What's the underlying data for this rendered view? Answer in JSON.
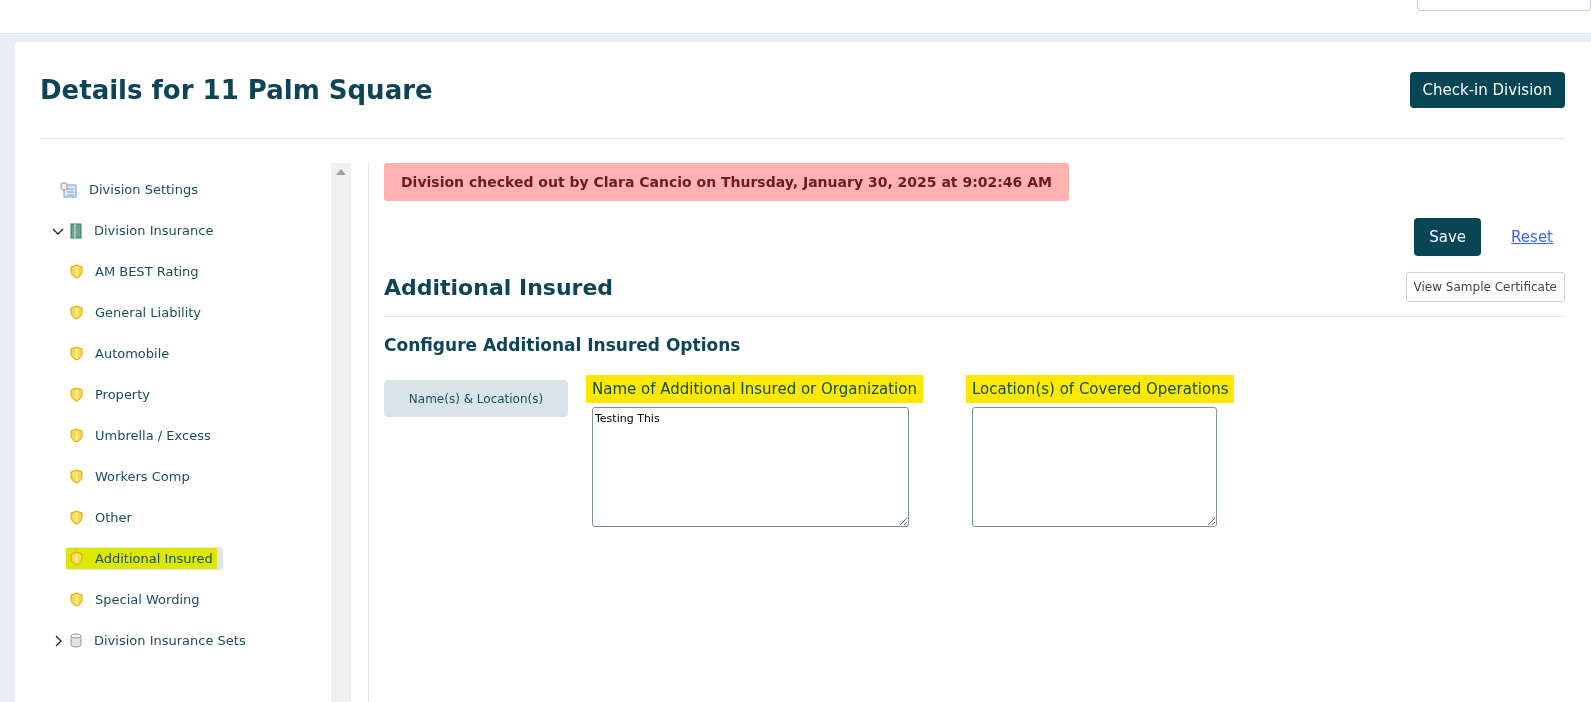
{
  "header": {
    "title": "Details for 11 Palm Square",
    "checkin_button": "Check-in Division"
  },
  "sidebar": {
    "items": [
      {
        "label": "Division Settings",
        "kind": "settings",
        "selected": false,
        "highlighted": false
      },
      {
        "label": "Division Insurance",
        "kind": "book",
        "selected": false,
        "highlighted": false,
        "expanded": true,
        "children": [
          {
            "label": "AM BEST Rating",
            "kind": "shield",
            "selected": false,
            "highlighted": false
          },
          {
            "label": "General Liability",
            "kind": "shield",
            "selected": false,
            "highlighted": false
          },
          {
            "label": "Automobile",
            "kind": "shield",
            "selected": false,
            "highlighted": false
          },
          {
            "label": "Property",
            "kind": "shield",
            "selected": false,
            "highlighted": false
          },
          {
            "label": "Umbrella / Excess",
            "kind": "shield",
            "selected": false,
            "highlighted": false
          },
          {
            "label": "Workers Comp",
            "kind": "shield",
            "selected": false,
            "highlighted": false
          },
          {
            "label": "Other",
            "kind": "shield",
            "selected": false,
            "highlighted": false
          },
          {
            "label": "Additional Insured",
            "kind": "shield",
            "selected": true,
            "highlighted": true
          },
          {
            "label": "Special Wording",
            "kind": "shield",
            "selected": false,
            "highlighted": false
          }
        ]
      },
      {
        "label": "Division Insurance Sets",
        "kind": "cylinder",
        "selected": false,
        "highlighted": false,
        "expanded": false
      }
    ]
  },
  "alert": "Division checked out by Clara Cancio on Thursday, January 30, 2025 at 9:02:46 AM",
  "actions": {
    "save": "Save",
    "reset": "Reset"
  },
  "section": {
    "title": "Additional Insured",
    "sample_button": "View Sample Certificate",
    "subtitle": "Configure Additional Insured Options"
  },
  "tab": {
    "label": "Name(s) & Location(s)"
  },
  "fields": [
    {
      "label": "Name of Additional Insured or Organization",
      "value": "Testing This",
      "highlighted": true
    },
    {
      "label": "Location(s) of Covered Operations",
      "highlighted": true
    }
  ]
}
